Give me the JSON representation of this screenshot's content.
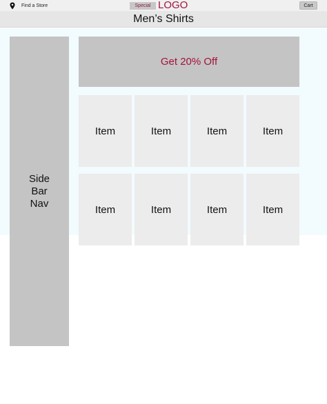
{
  "header": {
    "find_store_icon": "map-pin-icon",
    "find_store_label": "Find a Store",
    "special_label": "Special",
    "logo_text": "LOGO",
    "cart_label": "Cart"
  },
  "page": {
    "title": "Men’s Shirts"
  },
  "sidebar": {
    "label": "Side Bar Nav"
  },
  "promo": {
    "label": "Get 20% Off"
  },
  "grid": {
    "items": [
      {
        "label": "Item"
      },
      {
        "label": "Item"
      },
      {
        "label": "Item"
      },
      {
        "label": "Item"
      },
      {
        "label": "Item"
      },
      {
        "label": "Item"
      },
      {
        "label": "Item"
      },
      {
        "label": "Item"
      }
    ]
  },
  "colors": {
    "accent": "#a3123a",
    "placeholder_dark": "#c4c4c4",
    "placeholder_light": "#ececec",
    "content_background": "#f2fbfd"
  }
}
